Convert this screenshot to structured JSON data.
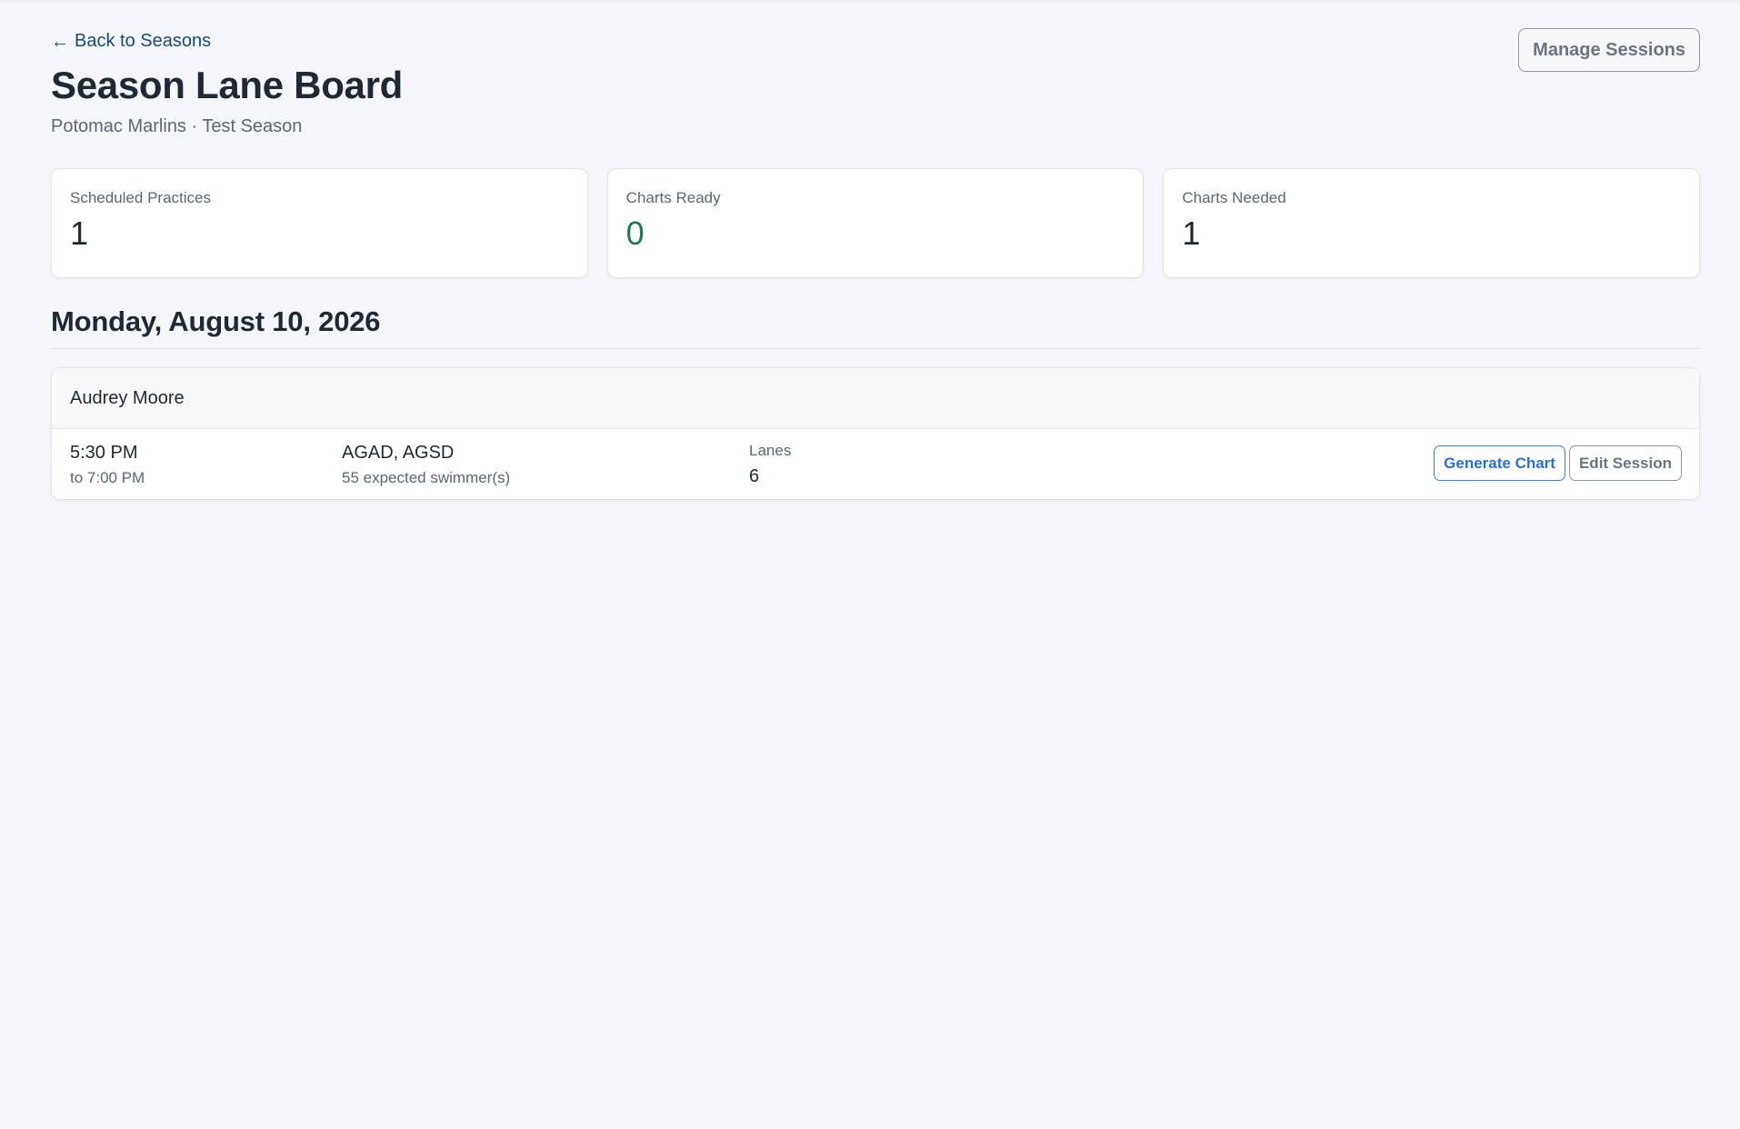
{
  "header": {
    "back_icon": "arrow-left-icon",
    "back_glyph": "←",
    "back_label": "Back to Seasons",
    "title": "Season Lane Board",
    "subtitle": "Potomac Marlins · Test Season",
    "manage_sessions_label": "Manage Sessions"
  },
  "stats": [
    {
      "label": "Scheduled Practices",
      "value": "1"
    },
    {
      "label": "Charts Ready",
      "value": "0",
      "color": "#1f7a4f"
    },
    {
      "label": "Charts Needed",
      "value": "1"
    }
  ],
  "days": [
    {
      "date": "Monday, August 10, 2026",
      "coach": "Audrey Moore",
      "session": {
        "start_time": "5:30 PM",
        "end_time": "to 7:00 PM",
        "groups": "AGAD, AGSD",
        "expected": "55 expected swimmer(s)",
        "lanes_label": "Lanes",
        "lanes_value": "6",
        "generate_label": "Generate Chart",
        "edit_label": "Edit Session"
      }
    }
  ],
  "colors": {
    "accent": "#3b82e6",
    "ready_green": "#1f7a4f",
    "background": "#f4f6f9"
  }
}
